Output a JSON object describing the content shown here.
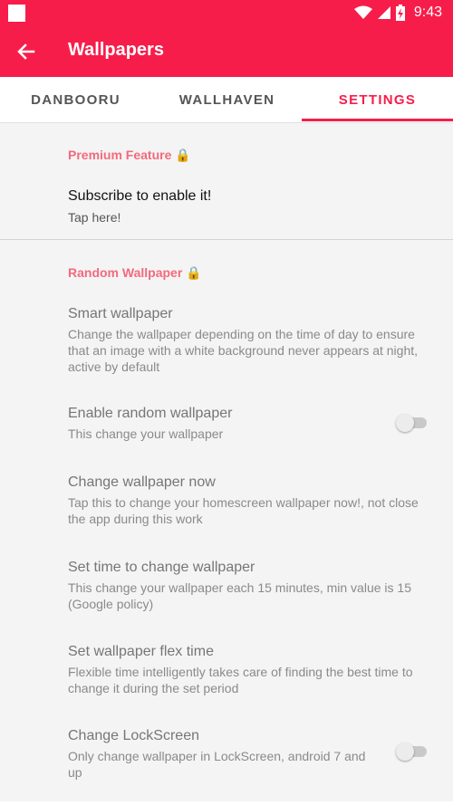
{
  "status_bar": {
    "time": "9:43",
    "icons": [
      "notification-square-icon",
      "wifi-icon",
      "signal-icon",
      "battery-icon"
    ]
  },
  "app_bar": {
    "title": "Wallpapers",
    "back_icon": "arrow-left-icon"
  },
  "tabs": [
    {
      "label": "DANBOORU",
      "selected": false
    },
    {
      "label": "WALLHAVEN",
      "selected": false
    },
    {
      "label": "SETTINGS",
      "selected": true
    }
  ],
  "premium": {
    "header": "Premium Feature 🔒",
    "title": "Subscribe to enable it!",
    "summary": "Tap here!"
  },
  "random_wallpaper": {
    "header": "Random Wallpaper 🔒",
    "items": [
      {
        "title": "Smart wallpaper",
        "summary": "Change the wallpaper depending on the time of day to ensure that an image with a white background never appears at night, active by default"
      },
      {
        "title": "Enable random wallpaper",
        "summary": "This change your wallpaper",
        "switch_on": false
      },
      {
        "title": "Change wallpaper now",
        "summary": "Tap this to change your homescreen wallpaper now!, not close the app during this work"
      },
      {
        "title": "Set time to change wallpaper",
        "summary": "This change your wallpaper each 15 minutes, min value is 15 (Google policy)"
      },
      {
        "title": "Set wallpaper flex time",
        "summary": "Flexible time intelligently takes care of finding the best time to change it during the set period"
      },
      {
        "title": "Change LockScreen",
        "summary": "Only change wallpaper in LockScreen, android 7 and up",
        "switch_on": false
      }
    ]
  },
  "colors": {
    "accent": "#f71d4a",
    "section_header": "#f36a7c",
    "background": "#f4f4f4"
  }
}
